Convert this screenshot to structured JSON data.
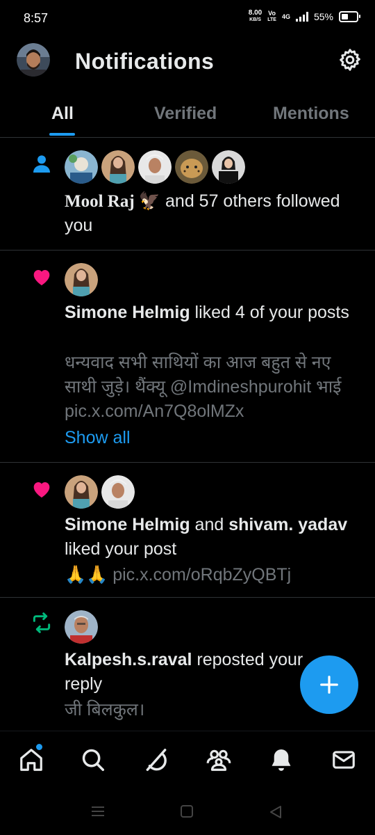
{
  "status_bar": {
    "time": "8:57",
    "speed_value": "8.00",
    "speed_unit": "KB/S",
    "volte_top": "Vo",
    "volte_bottom": "LTE",
    "network": "4G",
    "battery": "55%",
    "battery_level": 0.55
  },
  "header": {
    "title": "Notifications",
    "settings_icon": "gear-icon"
  },
  "tabs": [
    {
      "label": "All",
      "active": true
    },
    {
      "label": "Verified",
      "active": false
    },
    {
      "label": "Mentions",
      "active": false
    }
  ],
  "notifications": [
    {
      "type": "follow",
      "icon": "person-icon",
      "user": "Mool Raj 🦅",
      "text": " and 57 others followed you",
      "avatar_count": 5
    },
    {
      "type": "like",
      "icon": "heart-icon",
      "user": "Simone Helmig",
      "text": " liked 4 of your posts",
      "preview_line1": "धन्यवाद सभी साथियों का आज बहुत से नए",
      "preview_line2": "साथी जुड़े। थैंक्यू @Imdineshpurohit भाई",
      "preview_line3": "pic.x.com/An7Q8olMZx",
      "show_all": "Show all"
    },
    {
      "type": "like",
      "icon": "heart-icon",
      "user": "Simone Helmig",
      "and": " and ",
      "user2": "shivam. yadav",
      "text": "liked your post",
      "preview_emoji": "🙏🙏",
      "preview_link": " pic.x.com/oRqbZyQBTj"
    },
    {
      "type": "repost",
      "icon": "repost-icon",
      "user": "Kalpesh.s.raval",
      "text": " reposted your reply",
      "preview": "जी बिलकुल।"
    }
  ],
  "fab": {
    "icon": "plus-icon"
  },
  "bottom_nav": [
    "home-icon",
    "search-icon",
    "grok-icon",
    "communities-icon",
    "notifications-bell-icon",
    "messages-mail-icon"
  ],
  "system_nav": [
    "recents-icon",
    "home-square-icon",
    "back-icon"
  ],
  "colors": {
    "accent": "#1d9bf0",
    "heart": "#f91880",
    "repost": "#00ba7c",
    "muted": "#71767b"
  }
}
